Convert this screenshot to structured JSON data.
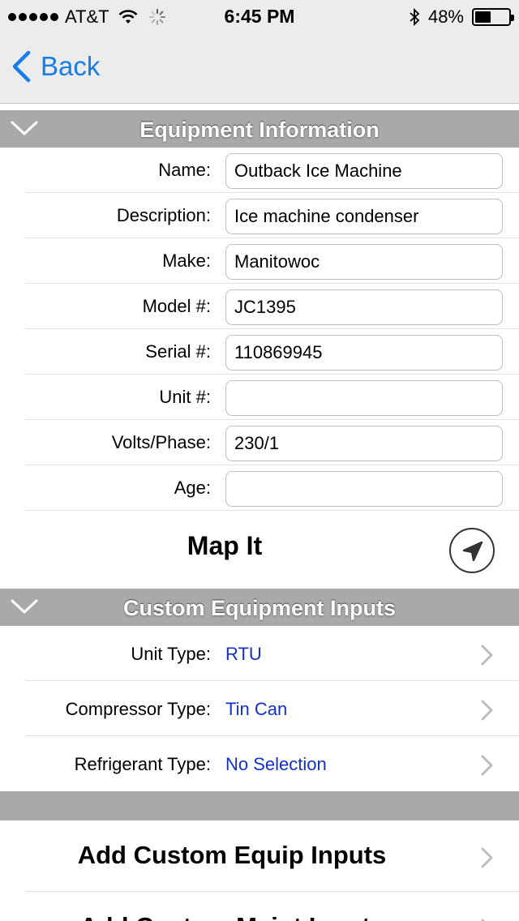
{
  "status_bar": {
    "carrier": "AT&T",
    "time": "6:45 PM",
    "battery": "48%",
    "battery_level": 0.48
  },
  "nav": {
    "back_label": "Back"
  },
  "equipment_section": {
    "title": "Equipment Information",
    "fields": [
      {
        "label": "Name:",
        "value": "Outback Ice Machine"
      },
      {
        "label": "Description:",
        "value": "Ice machine condenser"
      },
      {
        "label": "Make:",
        "value": "Manitowoc"
      },
      {
        "label": "Model #:",
        "value": "JC1395"
      },
      {
        "label": "Serial #:",
        "value": "110869945"
      },
      {
        "label": "Unit #:",
        "value": ""
      },
      {
        "label": "Volts/Phase:",
        "value": "230/1"
      },
      {
        "label": "Age:",
        "value": ""
      }
    ],
    "map_label": "Map It"
  },
  "custom_section": {
    "title": "Custom Equipment Inputs",
    "rows": [
      {
        "label": "Unit Type:",
        "value": "RTU"
      },
      {
        "label": "Compressor Type:",
        "value": "Tin Can"
      },
      {
        "label": "Refrigerant Type:",
        "value": "No Selection"
      }
    ]
  },
  "actions": [
    {
      "label": "Add Custom Equip Inputs"
    },
    {
      "label": "Add Custom Maint Inputs"
    }
  ],
  "colors": {
    "accent": "#177de8",
    "link_value": "#1530c9",
    "section_header": "#a9a9a9"
  }
}
